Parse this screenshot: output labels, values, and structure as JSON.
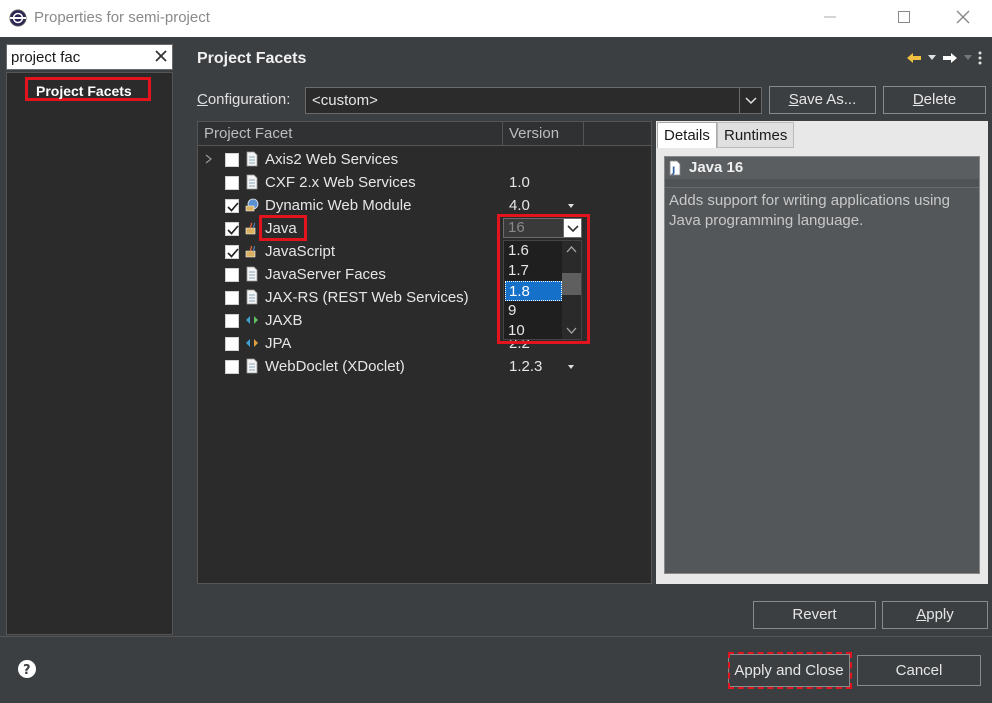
{
  "window": {
    "title": "Properties for semi-project"
  },
  "filter": {
    "value": "project fac"
  },
  "nav": {
    "selected_item": "Project Facets"
  },
  "page": {
    "title": "Project Facets"
  },
  "configuration": {
    "label_prefix": "C",
    "label_rest": "onfiguration:",
    "value": "<custom>",
    "save_as_u": "S",
    "save_as_rest": "ave As...",
    "delete_u": "D",
    "delete_rest": "elete"
  },
  "table": {
    "col_facet": "Project Facet",
    "col_version": "Version",
    "rows": [
      {
        "name": "Axis2 Web Services",
        "version": "",
        "checked": false
      },
      {
        "name": "CXF 2.x Web Services",
        "version": "1.0",
        "checked": false
      },
      {
        "name": "Dynamic Web Module",
        "version": "4.0",
        "checked": true
      },
      {
        "name": "Java",
        "version": "",
        "checked": true
      },
      {
        "name": "JavaScript",
        "version": "",
        "checked": true
      },
      {
        "name": "JavaServer Faces",
        "version": "",
        "checked": false
      },
      {
        "name": "JAX-RS (REST Web Services)",
        "version": "",
        "checked": false
      },
      {
        "name": "JAXB",
        "version": "",
        "checked": false
      },
      {
        "name": "JPA",
        "version": "2.2",
        "checked": false
      },
      {
        "name": "WebDoclet (XDoclet)",
        "version": "1.2.3",
        "checked": false
      }
    ]
  },
  "version_dropdown": {
    "current": "16",
    "options": [
      "1.6",
      "1.7",
      "1.8",
      "9",
      "10"
    ],
    "selected": "1.8"
  },
  "details": {
    "tab_details": "Details",
    "tab_runtimes": "Runtimes",
    "title": "Java 16",
    "description": "Adds support for writing applications using Java programming language."
  },
  "buttons": {
    "revert": "Revert",
    "apply_u": "A",
    "apply_rest": "pply",
    "apply_close": "Apply and Close",
    "cancel": "Cancel"
  }
}
